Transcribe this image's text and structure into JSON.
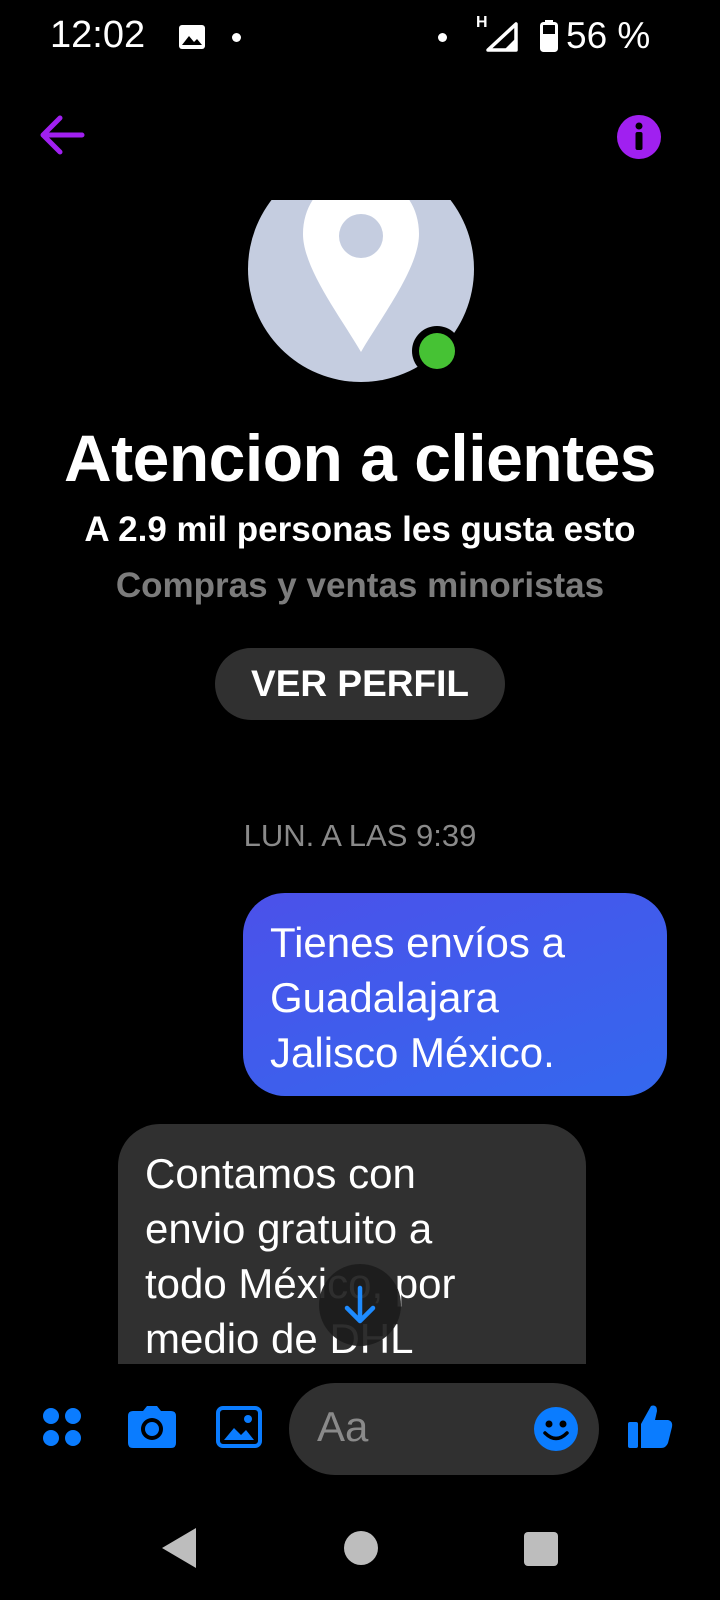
{
  "status_bar": {
    "time": "12:02",
    "network": "H",
    "battery_percent": "56 %",
    "icons": [
      "image-notification-icon",
      "signal-icon",
      "battery-icon"
    ]
  },
  "header": {
    "back_icon": "arrow-left-icon",
    "info_icon": "info-icon"
  },
  "profile": {
    "avatar_icon": "map-pin-icon",
    "online": true,
    "name": "Atencion a clientes",
    "likes": "A 2.9 mil personas les gusta esto",
    "category": "Compras y ventas minoristas",
    "view_profile_label": "VER PERFIL"
  },
  "conversation": {
    "timestamp": "LUN. A LAS 9:39",
    "messages": [
      {
        "direction": "outgoing",
        "text": "Tienes envíos a\nGuadalajara\nJalisco México."
      },
      {
        "direction": "incoming",
        "text": "Contamos con\nenvio gratuito a\ntodo México, por\nmedio de DHL"
      }
    ],
    "scroll_down_icon": "arrow-down-icon"
  },
  "composer": {
    "placeholder": "Aa",
    "icons": [
      "apps-icon",
      "camera-icon",
      "gallery-icon",
      "emoji-icon",
      "thumbs-up-icon"
    ]
  },
  "nav_bar": {
    "icons": [
      "nav-back-icon",
      "nav-home-icon",
      "nav-recents-icon"
    ]
  },
  "colors": {
    "accent_purple": "#a020f0",
    "messenger_blue": "#0a7cff",
    "outgoing_bubble": "#4660ec",
    "incoming_bubble": "#303030",
    "online_green": "#46c234"
  }
}
